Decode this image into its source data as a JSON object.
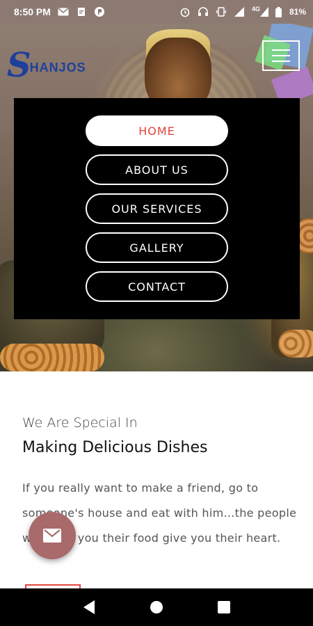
{
  "status_bar": {
    "time": "8:50 PM",
    "network": "4G",
    "battery": "81%",
    "left_icons": [
      "mail-icon",
      "clipboard-icon",
      "p-icon"
    ],
    "right_icons": [
      "alarm-icon",
      "headset-icon",
      "vibrate-icon",
      "signal-icon",
      "network-signal-icon",
      "battery-icon"
    ]
  },
  "logo": {
    "initial": "S",
    "text": "HANJOS"
  },
  "menu": {
    "items": [
      {
        "label": "HOME",
        "active": true
      },
      {
        "label": "ABOUT US",
        "active": false
      },
      {
        "label": "OUR SERVICES",
        "active": false
      },
      {
        "label": "GALLERY",
        "active": false
      },
      {
        "label": "CONTACT",
        "active": false
      }
    ]
  },
  "content": {
    "subtitle": "We Are Special In",
    "heading": "Making Delicious Dishes",
    "paragraph": "If you really want to make a friend, go to someone's house and eat with him...the people who give you their food give you their heart."
  },
  "fab": {
    "icon": "mail-icon"
  },
  "nav_bar": {
    "icons": [
      "back-icon",
      "home-icon",
      "recents-icon"
    ]
  },
  "colors": {
    "status_bar_bg": "#8c7a72",
    "logo_blue": "#1e3f9b",
    "menu_bg": "#000000",
    "active_text": "#e0443c",
    "fab_bg": "#a86a6a"
  }
}
